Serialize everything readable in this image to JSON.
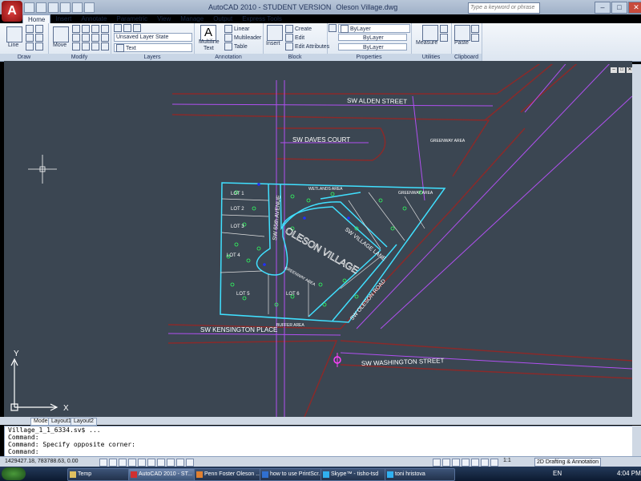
{
  "window": {
    "title": "AutoCAD 2010 - STUDENT VERSION",
    "file": "Oleson Village.dwg",
    "search_placeholder": "Type a keyword or phrase"
  },
  "tabs": [
    "Home",
    "Insert",
    "Annotate",
    "Parametric",
    "View",
    "Manage",
    "Output",
    "Express Tools"
  ],
  "ribbon": {
    "draw": {
      "label": "Draw",
      "line": "Line"
    },
    "modify": {
      "label": "Modify",
      "move": "Move"
    },
    "layers": {
      "label": "Layers",
      "state": "Unsaved Layer State",
      "layer": "Text"
    },
    "annotation": {
      "label": "Annotation",
      "multiline": "Multiline",
      "text": "Text",
      "linear": "Linear",
      "multileader": "Multileader",
      "table": "Table"
    },
    "block": {
      "label": "Block",
      "insert": "Insert",
      "create": "Create",
      "edit": "Edit",
      "edit_attributes": "Edit Attributes"
    },
    "properties": {
      "label": "Properties",
      "color": "ByLayer",
      "linetype": "ByLayer",
      "lineweight": "ByLayer"
    },
    "utilities": {
      "label": "Utilities",
      "measure": "Measure"
    },
    "clipboard": {
      "label": "Clipboard",
      "paste": "Paste"
    }
  },
  "drawing": {
    "streets": {
      "alden": "SW ALDEN STREET",
      "daves": "SW DAVES COURT",
      "avenue": "SW 65th AVENUE",
      "village_lane": "SW VILLAGE LANE",
      "oleson_road": "SW OLESON ROAD",
      "kensington": "SW KENSINGTON PLACE",
      "washington": "SW WASHINGTON STREET"
    },
    "title": "OLESON VILLAGE",
    "lots": [
      "LOT 1",
      "LOT 2",
      "LOT 3",
      "LOT 4",
      "LOT 5",
      "LOT 6"
    ],
    "areas": {
      "wetlands": "WETLANDS AREA",
      "greenway": "GREENWAY AREA",
      "greenway2": "GREENWAY AREA",
      "greenway3": "GREENWAY AREA",
      "buffer": "BUFFER AREA"
    },
    "axis": {
      "x": "X",
      "y": "Y"
    }
  },
  "layout_tabs": [
    "Model",
    "Layout1",
    "Layout2"
  ],
  "command_lines": [
    "Village_1_1_6334.sv$ ...",
    "Command:",
    "Command: Specify opposite corner:",
    "Command:"
  ],
  "status": {
    "coords": "1429427.18, 783788.63, 0.00",
    "scale": "1:1",
    "workspace": "2D Drafting & Annotation"
  },
  "taskbar": {
    "items": [
      "Temp",
      "AutoCAD 2010 - ST...",
      "Penn Foster Oleson ...",
      "how to use PrintScr...",
      "Skype™ - tisho-tsd",
      "toni hristova"
    ],
    "language": "EN",
    "clock": "4:04 PM"
  },
  "colors": {
    "canvas": "#3b4652",
    "boundary": "#40e0ff",
    "street": "#c060ff",
    "magenta": "#ff40ff",
    "green_marker": "#30ff60",
    "blue_marker": "#2030ff"
  }
}
